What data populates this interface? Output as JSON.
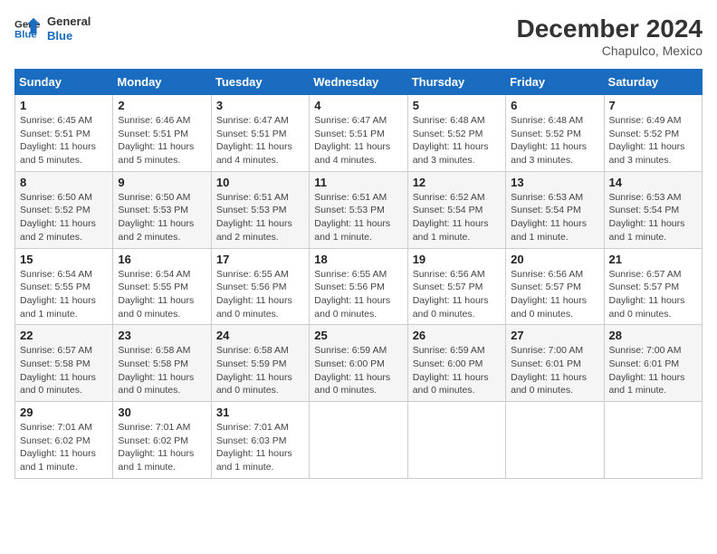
{
  "logo": {
    "line1": "General",
    "line2": "Blue"
  },
  "title": "December 2024",
  "location": "Chapulco, Mexico",
  "days_header": [
    "Sunday",
    "Monday",
    "Tuesday",
    "Wednesday",
    "Thursday",
    "Friday",
    "Saturday"
  ],
  "weeks": [
    [
      {
        "day": "1",
        "sunrise": "6:45 AM",
        "sunset": "5:51 PM",
        "daylight": "11 hours and 5 minutes."
      },
      {
        "day": "2",
        "sunrise": "6:46 AM",
        "sunset": "5:51 PM",
        "daylight": "11 hours and 5 minutes."
      },
      {
        "day": "3",
        "sunrise": "6:47 AM",
        "sunset": "5:51 PM",
        "daylight": "11 hours and 4 minutes."
      },
      {
        "day": "4",
        "sunrise": "6:47 AM",
        "sunset": "5:51 PM",
        "daylight": "11 hours and 4 minutes."
      },
      {
        "day": "5",
        "sunrise": "6:48 AM",
        "sunset": "5:52 PM",
        "daylight": "11 hours and 3 minutes."
      },
      {
        "day": "6",
        "sunrise": "6:48 AM",
        "sunset": "5:52 PM",
        "daylight": "11 hours and 3 minutes."
      },
      {
        "day": "7",
        "sunrise": "6:49 AM",
        "sunset": "5:52 PM",
        "daylight": "11 hours and 3 minutes."
      }
    ],
    [
      {
        "day": "8",
        "sunrise": "6:50 AM",
        "sunset": "5:52 PM",
        "daylight": "11 hours and 2 minutes."
      },
      {
        "day": "9",
        "sunrise": "6:50 AM",
        "sunset": "5:53 PM",
        "daylight": "11 hours and 2 minutes."
      },
      {
        "day": "10",
        "sunrise": "6:51 AM",
        "sunset": "5:53 PM",
        "daylight": "11 hours and 2 minutes."
      },
      {
        "day": "11",
        "sunrise": "6:51 AM",
        "sunset": "5:53 PM",
        "daylight": "11 hours and 1 minute."
      },
      {
        "day": "12",
        "sunrise": "6:52 AM",
        "sunset": "5:54 PM",
        "daylight": "11 hours and 1 minute."
      },
      {
        "day": "13",
        "sunrise": "6:53 AM",
        "sunset": "5:54 PM",
        "daylight": "11 hours and 1 minute."
      },
      {
        "day": "14",
        "sunrise": "6:53 AM",
        "sunset": "5:54 PM",
        "daylight": "11 hours and 1 minute."
      }
    ],
    [
      {
        "day": "15",
        "sunrise": "6:54 AM",
        "sunset": "5:55 PM",
        "daylight": "11 hours and 1 minute."
      },
      {
        "day": "16",
        "sunrise": "6:54 AM",
        "sunset": "5:55 PM",
        "daylight": "11 hours and 0 minutes."
      },
      {
        "day": "17",
        "sunrise": "6:55 AM",
        "sunset": "5:56 PM",
        "daylight": "11 hours and 0 minutes."
      },
      {
        "day": "18",
        "sunrise": "6:55 AM",
        "sunset": "5:56 PM",
        "daylight": "11 hours and 0 minutes."
      },
      {
        "day": "19",
        "sunrise": "6:56 AM",
        "sunset": "5:57 PM",
        "daylight": "11 hours and 0 minutes."
      },
      {
        "day": "20",
        "sunrise": "6:56 AM",
        "sunset": "5:57 PM",
        "daylight": "11 hours and 0 minutes."
      },
      {
        "day": "21",
        "sunrise": "6:57 AM",
        "sunset": "5:57 PM",
        "daylight": "11 hours and 0 minutes."
      }
    ],
    [
      {
        "day": "22",
        "sunrise": "6:57 AM",
        "sunset": "5:58 PM",
        "daylight": "11 hours and 0 minutes."
      },
      {
        "day": "23",
        "sunrise": "6:58 AM",
        "sunset": "5:58 PM",
        "daylight": "11 hours and 0 minutes."
      },
      {
        "day": "24",
        "sunrise": "6:58 AM",
        "sunset": "5:59 PM",
        "daylight": "11 hours and 0 minutes."
      },
      {
        "day": "25",
        "sunrise": "6:59 AM",
        "sunset": "6:00 PM",
        "daylight": "11 hours and 0 minutes."
      },
      {
        "day": "26",
        "sunrise": "6:59 AM",
        "sunset": "6:00 PM",
        "daylight": "11 hours and 0 minutes."
      },
      {
        "day": "27",
        "sunrise": "7:00 AM",
        "sunset": "6:01 PM",
        "daylight": "11 hours and 0 minutes."
      },
      {
        "day": "28",
        "sunrise": "7:00 AM",
        "sunset": "6:01 PM",
        "daylight": "11 hours and 1 minute."
      }
    ],
    [
      {
        "day": "29",
        "sunrise": "7:01 AM",
        "sunset": "6:02 PM",
        "daylight": "11 hours and 1 minute."
      },
      {
        "day": "30",
        "sunrise": "7:01 AM",
        "sunset": "6:02 PM",
        "daylight": "11 hours and 1 minute."
      },
      {
        "day": "31",
        "sunrise": "7:01 AM",
        "sunset": "6:03 PM",
        "daylight": "11 hours and 1 minute."
      },
      null,
      null,
      null,
      null
    ]
  ],
  "labels": {
    "sunrise": "Sunrise:",
    "sunset": "Sunset:",
    "daylight": "Daylight:"
  }
}
